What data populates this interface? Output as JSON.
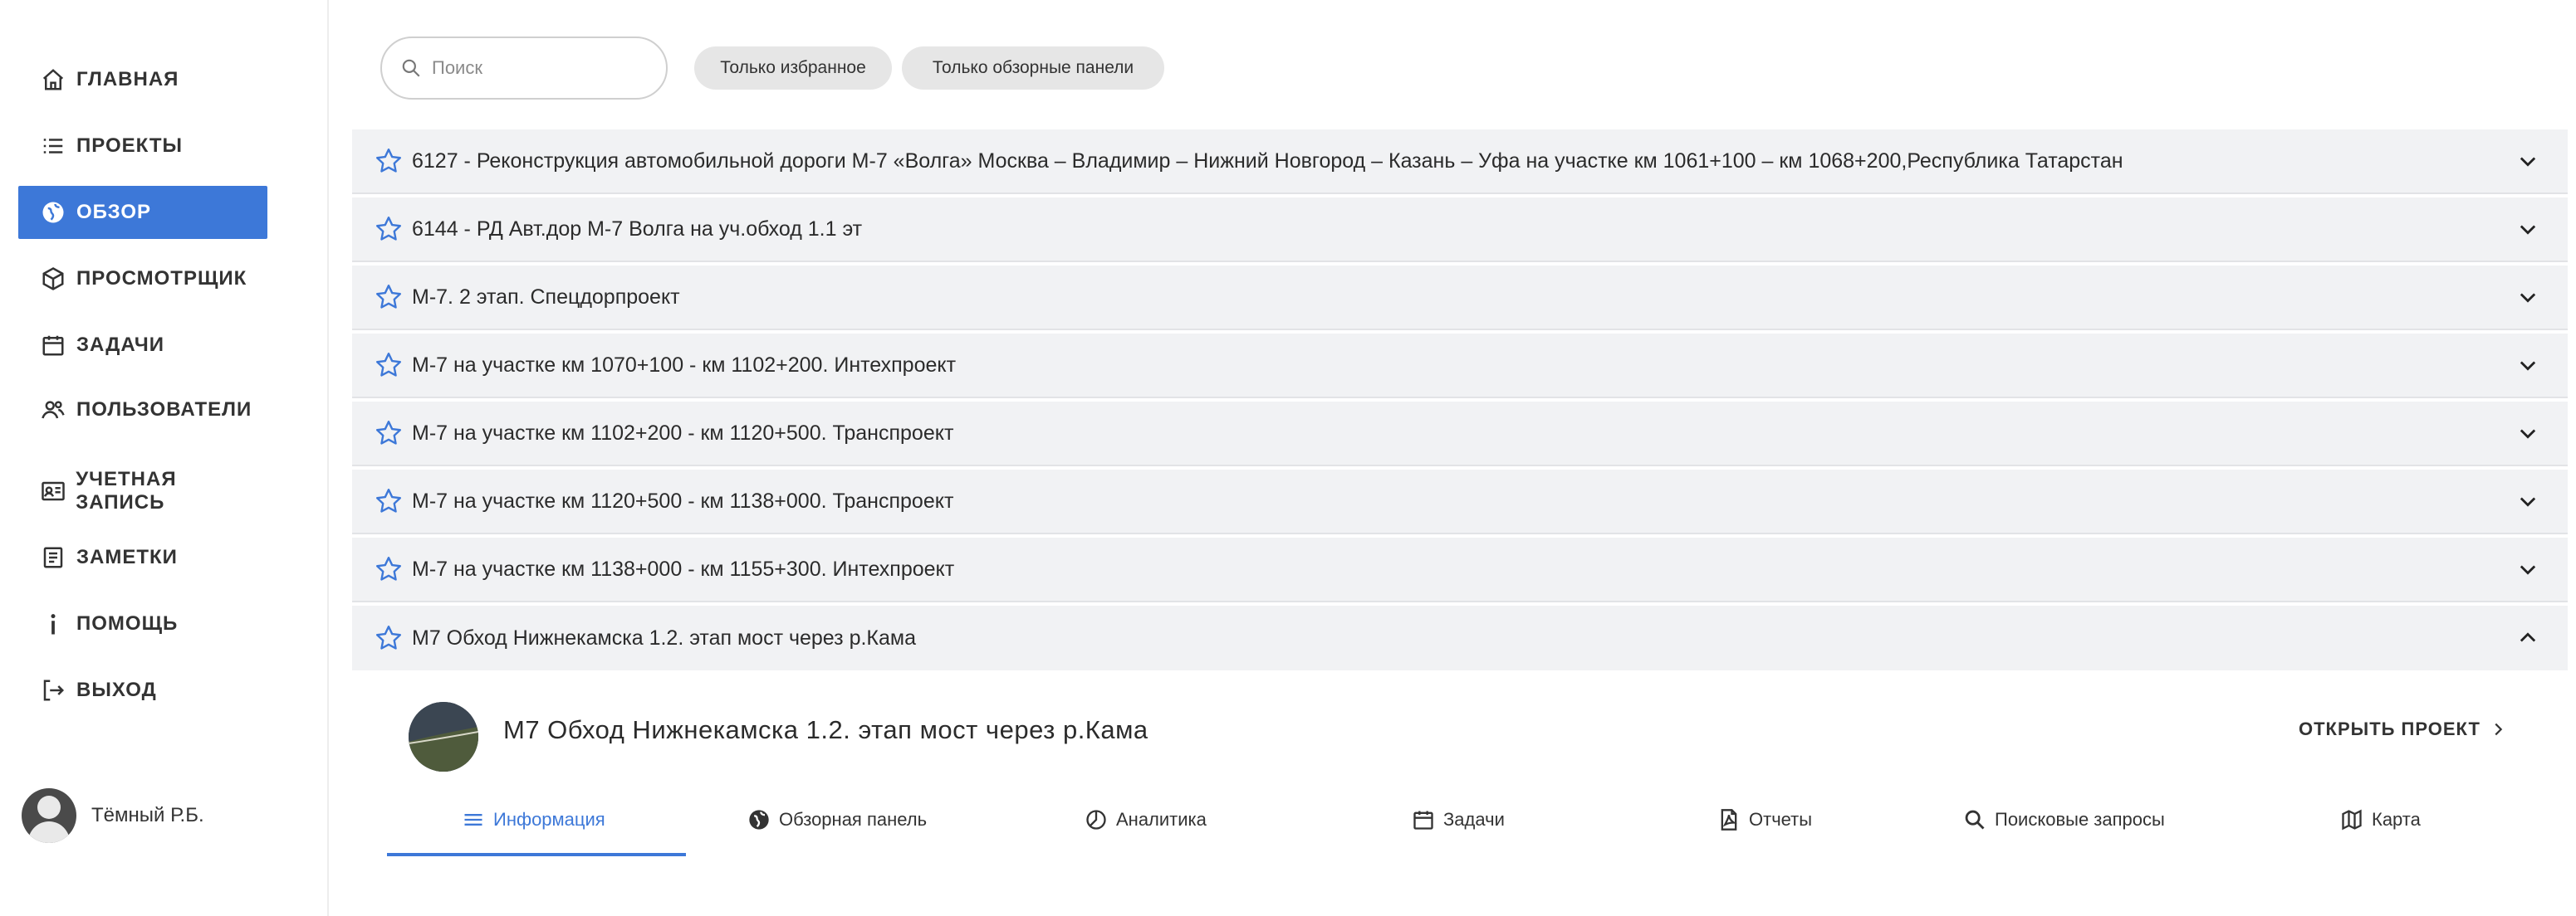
{
  "sidebar": {
    "items": [
      {
        "label": "ГЛАВНАЯ",
        "icon": "home-icon"
      },
      {
        "label": "ПРОЕКТЫ",
        "icon": "list-icon"
      },
      {
        "label": "ОБЗОР",
        "icon": "globe-icon",
        "active": true
      },
      {
        "label": "ПРОСМОТРЩИК",
        "icon": "cube-icon"
      },
      {
        "label": "ЗАДАЧИ",
        "icon": "calendar-icon"
      },
      {
        "label": "ПОЛЬЗОВАТЕЛИ",
        "icon": "users-icon"
      },
      {
        "label": "УЧЕТНАЯ ЗАПИСЬ",
        "icon": "id-card-icon"
      },
      {
        "label": "ЗАМЕТКИ",
        "icon": "notes-icon"
      },
      {
        "label": "ПОМОЩЬ",
        "icon": "info-icon"
      },
      {
        "label": "ВЫХОД",
        "icon": "logout-icon"
      }
    ],
    "user": {
      "name": "Тёмный Р.Б."
    }
  },
  "filters": {
    "search_placeholder": "Поиск",
    "chip_favorites": "Только избранное",
    "chip_overview": "Только обзорные панели"
  },
  "projects": [
    {
      "title": "6127 - Реконструкция автомобильной дороги М-7 «Волга» Москва – Владимир – Нижний Новгород – Казань – Уфа на участке км 1061+100 – км 1068+200,Республика Татарстан",
      "expanded": false
    },
    {
      "title": "6144 - РД Авт.дор М-7 Волга на уч.обход 1.1 эт",
      "expanded": false
    },
    {
      "title": "М-7. 2 этап. Спецдорпроект",
      "expanded": false
    },
    {
      "title": "М-7 на участке км 1070+100 - км 1102+200. Интехпроект",
      "expanded": false
    },
    {
      "title": "М-7 на участке км 1102+200 - км 1120+500. Транспроект",
      "expanded": false
    },
    {
      "title": "М-7 на участке км 1120+500 - км 1138+000. Транспроект",
      "expanded": false
    },
    {
      "title": "М-7 на участке км 1138+000 - км 1155+300. Интехпроект",
      "expanded": false
    },
    {
      "title": "М7 Обход Нижнекамска 1.2. этап мост через р.Кама",
      "expanded": true
    }
  ],
  "detail": {
    "title": "М7 Обход Нижнекамска 1.2. этап мост через р.Кама",
    "open_project": "ОТКРЫТЬ ПРОЕКТ",
    "tabs": [
      {
        "label": "Информация",
        "icon": "menu-icon",
        "active": true
      },
      {
        "label": "Обзорная панель",
        "icon": "globe-icon"
      },
      {
        "label": "Аналитика",
        "icon": "pie-chart-icon"
      },
      {
        "label": "Задачи",
        "icon": "calendar-icon"
      },
      {
        "label": "Отчеты",
        "icon": "pdf-file-icon"
      },
      {
        "label": "Поисковые запросы",
        "icon": "search-icon"
      },
      {
        "label": "Карта",
        "icon": "map-icon"
      }
    ]
  },
  "colors": {
    "accent": "#3d78d8",
    "row_bg": "#f1f2f4",
    "chip_bg": "#e6e6e6"
  }
}
